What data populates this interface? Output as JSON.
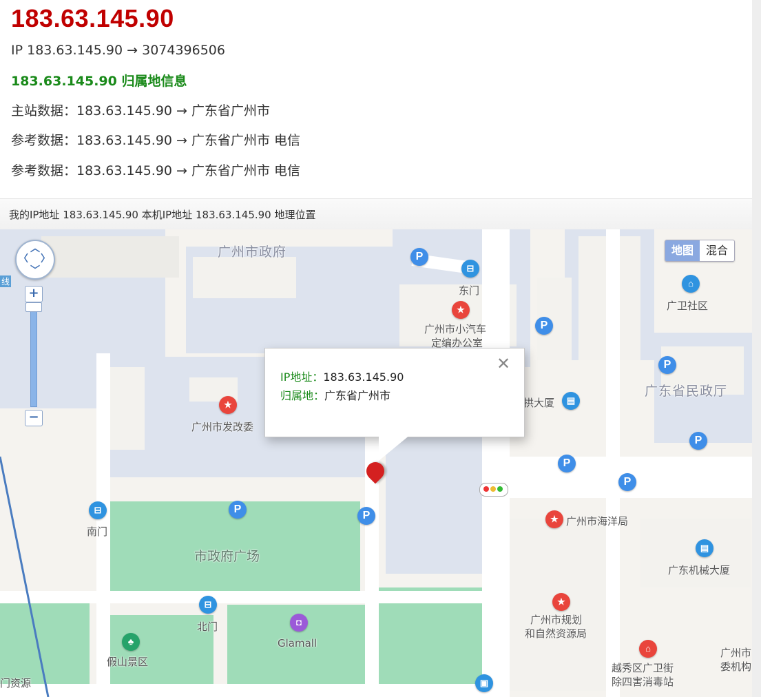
{
  "header": {
    "ip_title": "183.63.145.90",
    "ip_numeric_line": "IP 183.63.145.90 → 3074396506",
    "location_heading": "183.63.145.90 归属地信息",
    "main_data": "主站数据：183.63.145.90 → 广东省广州市",
    "ref_data_1": "参考数据：183.63.145.90 → 广东省广州市 电信",
    "ref_data_2": "参考数据：183.63.145.90 → 广东省广州市 电信"
  },
  "map_bar": {
    "text": "我的IP地址 183.63.145.90 本机IP地址 183.63.145.90 地理位置"
  },
  "map": {
    "type_active": "地图",
    "type_inactive": "混合",
    "zoom_in": "+",
    "zoom_out": "−",
    "popup": {
      "ip_key": "IP地址：",
      "ip_value": "183.63.145.90",
      "loc_key": "归属地：",
      "loc_value": "广东省广州市",
      "close": "✕"
    },
    "labels": {
      "gov": "广州市政府",
      "east_gate": "东门",
      "car_office_1": "广州市小汽车",
      "car_office_2": "定编办公室",
      "guangwei": "广卫社区",
      "civil_affairs": "广东省民政厅",
      "gong_building": "拱大厦",
      "fagai": "广州市发改委",
      "ocean": "广州市海洋局",
      "south_gate": "南门",
      "plaza": "市政府广场",
      "machinery": "广东机械大厦",
      "north_gate": "北门",
      "glamall": "Glamall",
      "planning_1": "广州市规划",
      "planning_2": "和自然资源局",
      "rockery": "假山景区",
      "yuexiu_1": "越秀区广卫街",
      "yuexiu_2": "除四害消毒站",
      "resource": "门资源",
      "committee_1": "广州市",
      "committee_2": "委机构",
      "edge_tag": "线"
    }
  },
  "colors": {
    "title_red": "#c00000",
    "heading_green": "#1a8a1a",
    "park_green": "#9fdcb8",
    "building_blue": "#dde3ee"
  }
}
